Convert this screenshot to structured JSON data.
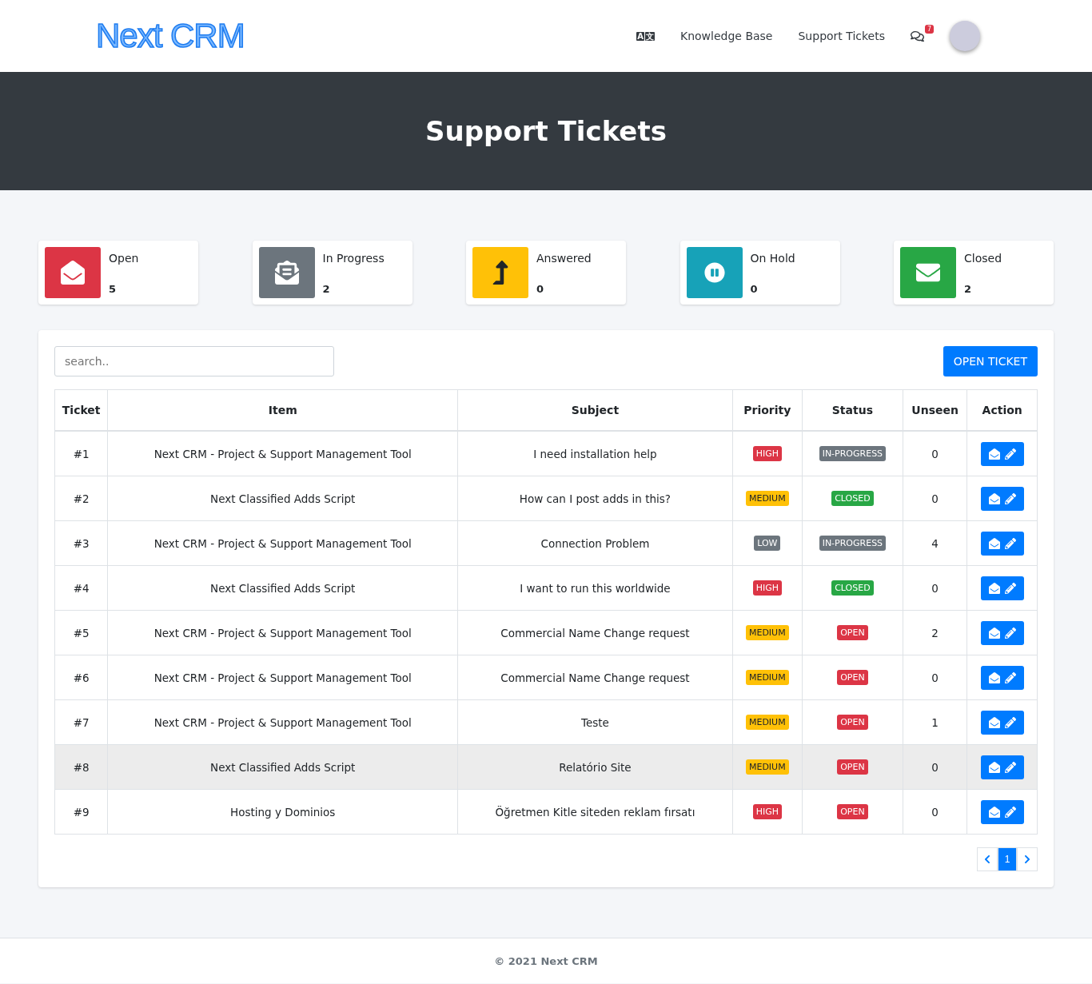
{
  "header": {
    "logo": "Next CRM",
    "nav": [
      {
        "label": "Knowledge Base"
      },
      {
        "label": "Support Tickets"
      }
    ],
    "messages_badge": "7",
    "language_toggle": [
      "A",
      "文"
    ]
  },
  "banner": {
    "title": "Support Tickets"
  },
  "stats": [
    {
      "kind": "open",
      "label": "Open",
      "count": "5",
      "color": "#dc3545"
    },
    {
      "kind": "progress",
      "label": "In Progress",
      "count": "2",
      "color": "#6c757d"
    },
    {
      "kind": "answered",
      "label": "Answered",
      "count": "0",
      "color": "#ffc107"
    },
    {
      "kind": "hold",
      "label": "On Hold",
      "count": "0",
      "color": "#17a2b8"
    },
    {
      "kind": "closed",
      "label": "Closed",
      "count": "2",
      "color": "#28a745"
    }
  ],
  "search": {
    "placeholder": "search.."
  },
  "open_ticket_button": "OPEN TICKET",
  "table": {
    "columns": [
      "Ticket",
      "Item",
      "Subject",
      "Priority",
      "Status",
      "Unseen",
      "Action"
    ],
    "rows": [
      {
        "ticket": "#1",
        "item": "Next CRM - Project & Support Management Tool",
        "subject": "I need installation help",
        "priority": {
          "text": "HIGH",
          "color": "#dc3545"
        },
        "status": {
          "text": "IN-PROGRESS",
          "color": "#6c757d"
        },
        "unseen": "0",
        "selected": false
      },
      {
        "ticket": "#2",
        "item": "Next Classified Adds Script",
        "subject": "How can I post adds in this?",
        "priority": {
          "text": "MEDIUM",
          "color": "#ffc107"
        },
        "status": {
          "text": "CLOSED",
          "color": "#28a745"
        },
        "unseen": "0",
        "selected": false
      },
      {
        "ticket": "#3",
        "item": "Next CRM - Project & Support Management Tool",
        "subject": "Connection Problem",
        "priority": {
          "text": "LOW",
          "color": "#6c757d"
        },
        "status": {
          "text": "IN-PROGRESS",
          "color": "#6c757d"
        },
        "unseen": "4",
        "selected": false
      },
      {
        "ticket": "#4",
        "item": "Next Classified Adds Script",
        "subject": "I want to run this worldwide",
        "priority": {
          "text": "HIGH",
          "color": "#dc3545"
        },
        "status": {
          "text": "CLOSED",
          "color": "#28a745"
        },
        "unseen": "0",
        "selected": false
      },
      {
        "ticket": "#5",
        "item": "Next CRM - Project & Support Management Tool",
        "subject": "Commercial Name Change request",
        "priority": {
          "text": "MEDIUM",
          "color": "#ffc107"
        },
        "status": {
          "text": "OPEN",
          "color": "#dc3545"
        },
        "unseen": "2",
        "selected": false
      },
      {
        "ticket": "#6",
        "item": "Next CRM - Project & Support Management Tool",
        "subject": "Commercial Name Change request",
        "priority": {
          "text": "MEDIUM",
          "color": "#ffc107"
        },
        "status": {
          "text": "OPEN",
          "color": "#dc3545"
        },
        "unseen": "0",
        "selected": false
      },
      {
        "ticket": "#7",
        "item": "Next CRM - Project & Support Management Tool",
        "subject": "Teste",
        "priority": {
          "text": "MEDIUM",
          "color": "#ffc107"
        },
        "status": {
          "text": "OPEN",
          "color": "#dc3545"
        },
        "unseen": "1",
        "selected": false
      },
      {
        "ticket": "#8",
        "item": "Next Classified Adds Script",
        "subject": "Relatório Site",
        "priority": {
          "text": "MEDIUM",
          "color": "#ffc107"
        },
        "status": {
          "text": "OPEN",
          "color": "#dc3545"
        },
        "unseen": "0",
        "selected": true
      },
      {
        "ticket": "#9",
        "item": "Hosting y Dominios",
        "subject": "Öğretmen Kitle siteden reklam fırsatı",
        "priority": {
          "text": "HIGH",
          "color": "#dc3545"
        },
        "status": {
          "text": "OPEN",
          "color": "#dc3545"
        },
        "unseen": "0",
        "selected": false
      }
    ]
  },
  "pagination": [
    {
      "label": "1",
      "selected": true
    }
  ],
  "footer": "© 2021 Next CRM"
}
